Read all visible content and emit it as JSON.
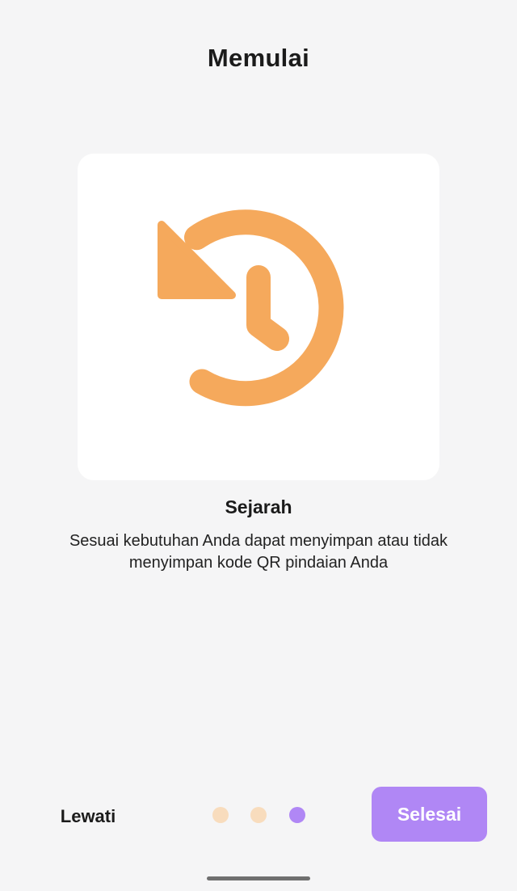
{
  "header": {
    "title": "Memulai"
  },
  "feature": {
    "icon": "history-icon",
    "title": "Sejarah",
    "description": "Sesuai kebutuhan Anda dapat menyimpan atau tidak menyimpan kode QR pindaian Anda"
  },
  "footer": {
    "skip_label": "Lewati",
    "finish_label": "Selesai",
    "pagination": {
      "total": 3,
      "current": 3
    }
  },
  "colors": {
    "accent": "#f5a95c",
    "accent_light": "#f8dcbd",
    "primary": "#b087f5",
    "background": "#f5f5f6",
    "card": "#ffffff"
  }
}
